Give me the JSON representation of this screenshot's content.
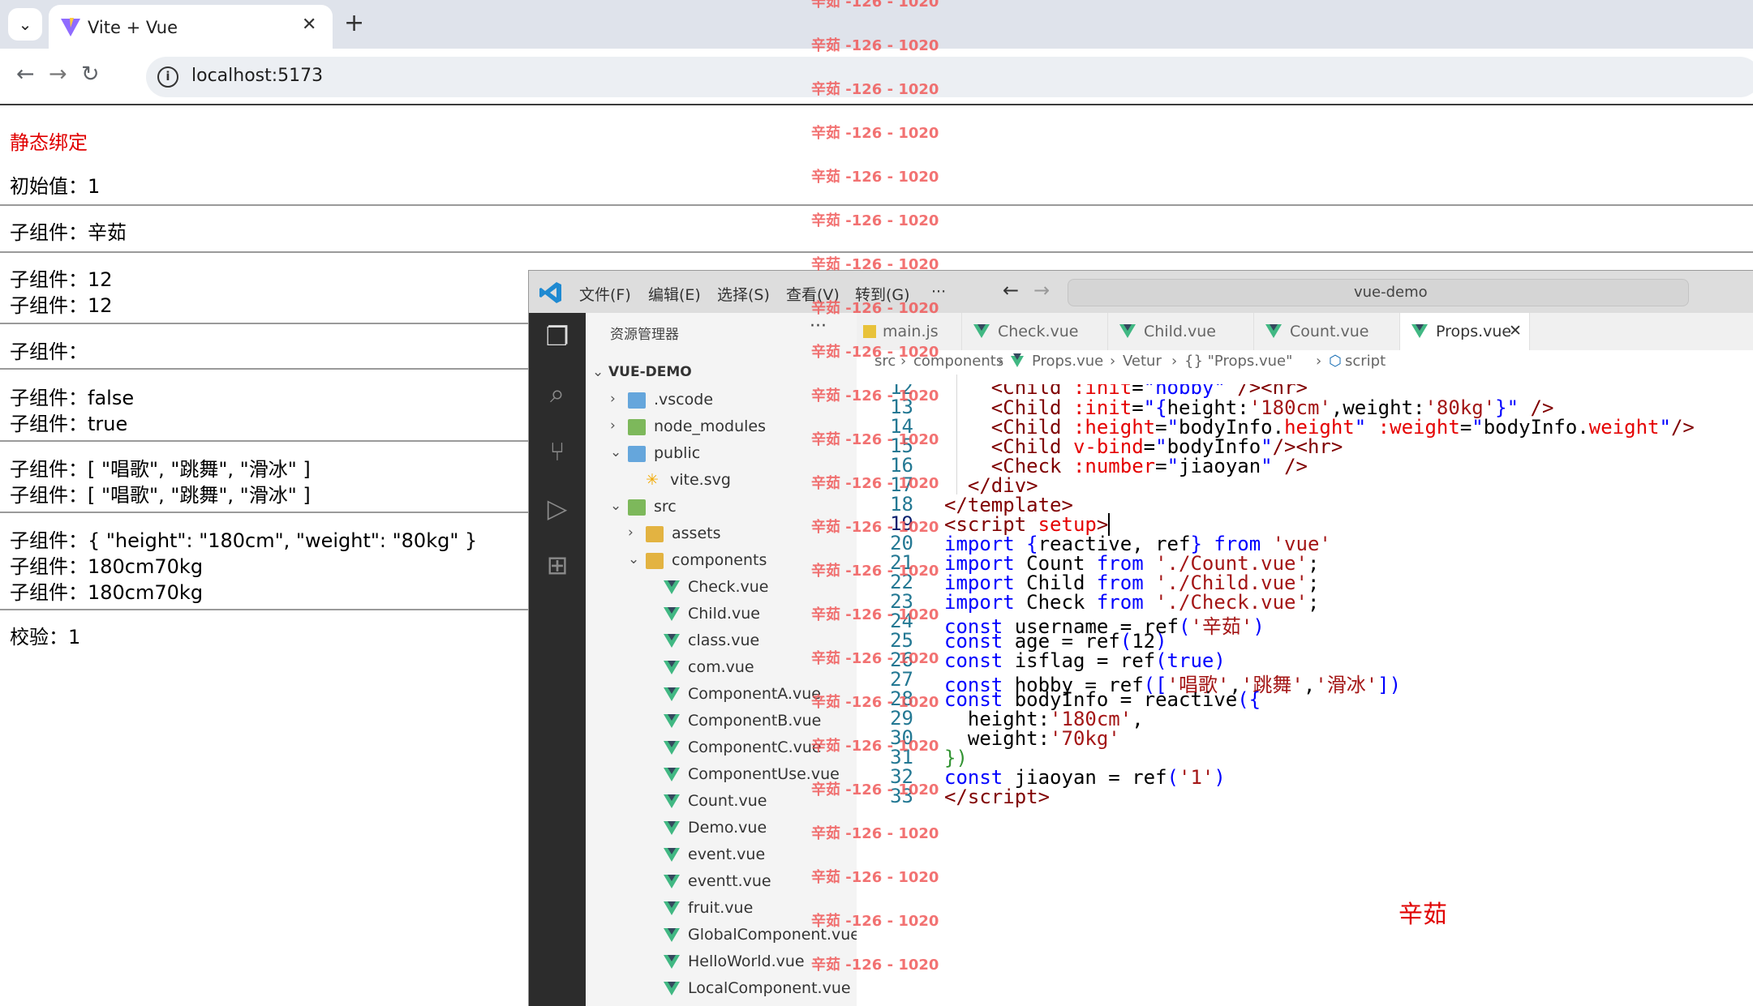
{
  "browser": {
    "tab_title": "Vite + Vue",
    "tab_close": "✕",
    "new_tab": "+",
    "back": "←",
    "forward": "→",
    "reload": "↻",
    "url": "localhost:5173"
  },
  "page": {
    "lines": [
      "静态绑定",
      "初始值：1",
      "子组件：辛茹",
      "子组件：12",
      "子组件：12",
      "子组件：",
      "子组件：false",
      "子组件：true",
      "子组件：[ \"唱歌\", \"跳舞\", \"滑冰\" ]",
      "子组件：[ \"唱歌\", \"跳舞\", \"滑冰\" ]",
      "子组件：{ \"height\": \"180cm\", \"weight\": \"80kg\" }",
      "子组件：180cm70kg",
      "子组件：180cm70kg",
      "校验：1"
    ]
  },
  "watermark": "辛茹 -126 - 1020",
  "vscode": {
    "menus": [
      "文件(F)",
      "编辑(E)",
      "选择(S)",
      "查看(V)",
      "转到(G)",
      "···"
    ],
    "command_center": "vue-demo",
    "explorer_title": "资源管理器",
    "explorer_more": "···",
    "tree": [
      {
        "label": "VUE-DEMO"
      },
      {
        "label": ".vscode"
      },
      {
        "label": "node_modules"
      },
      {
        "label": "public"
      },
      {
        "label": "vite.svg"
      },
      {
        "label": "src"
      },
      {
        "label": "assets"
      },
      {
        "label": "components"
      },
      {
        "label": "Check.vue"
      },
      {
        "label": "Child.vue"
      },
      {
        "label": "class.vue"
      },
      {
        "label": "com.vue"
      },
      {
        "label": "ComponentA.vue"
      },
      {
        "label": "ComponentB.vue"
      },
      {
        "label": "ComponentC.vue"
      },
      {
        "label": "ComponentUse.vue"
      },
      {
        "label": "Count.vue"
      },
      {
        "label": "Demo.vue"
      },
      {
        "label": "event.vue"
      },
      {
        "label": "eventt.vue"
      },
      {
        "label": "fruit.vue"
      },
      {
        "label": "GlobalComponent.vue"
      },
      {
        "label": "HelloWorld.vue"
      },
      {
        "label": "LocalComponent.vue"
      }
    ],
    "tabs": [
      "main.js",
      "Check.vue",
      "Child.vue",
      "Count.vue",
      "Props.vue"
    ],
    "tab_close": "✕",
    "breadcrumb": [
      "src",
      "components",
      "Props.vue",
      "Vetur",
      "{} \"Props.vue\"",
      "script"
    ],
    "line_numbers": [
      "12",
      "13",
      "14",
      "15",
      "16",
      "17",
      "18",
      "19",
      "20",
      "21",
      "22",
      "23",
      "24",
      "25",
      "26",
      "27",
      "28",
      "29",
      "30",
      "31",
      "32",
      "33"
    ],
    "annotation": "辛茹"
  }
}
